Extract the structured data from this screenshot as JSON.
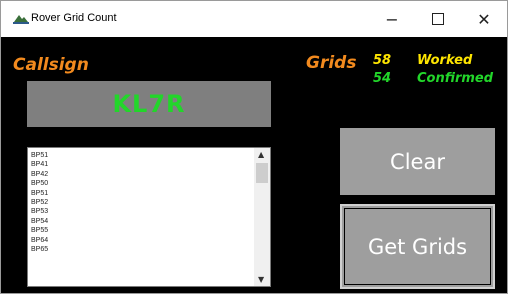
{
  "window": {
    "title": "Rover Grid Count",
    "minimize_glyph": "−",
    "close_glyph": "✕"
  },
  "callsign": {
    "label": "Callsign",
    "value": "KL7R"
  },
  "grids": {
    "label": "Grids",
    "worked_count": "58",
    "worked_label": "Worked",
    "confirmed_count": "54",
    "confirmed_label": "Confirmed"
  },
  "grid_list": {
    "items": [
      "BP51",
      "BP41",
      "BP42",
      "BP50",
      "BP51",
      "BP52",
      "BP53",
      "BP54",
      "BP55",
      "BP64",
      "BP65"
    ],
    "scroll_up_glyph": "▲",
    "scroll_down_glyph": "▼"
  },
  "buttons": {
    "clear": "Clear",
    "get_grids": "Get Grids"
  },
  "colors": {
    "background": "#000000",
    "orange_label": "#f28a1e",
    "yellow": "#ffe600",
    "green": "#22d62a",
    "button_gray": "#9e9e9e",
    "callsign_box": "#7f7f7f"
  },
  "icons": {
    "app": "app-icon"
  }
}
